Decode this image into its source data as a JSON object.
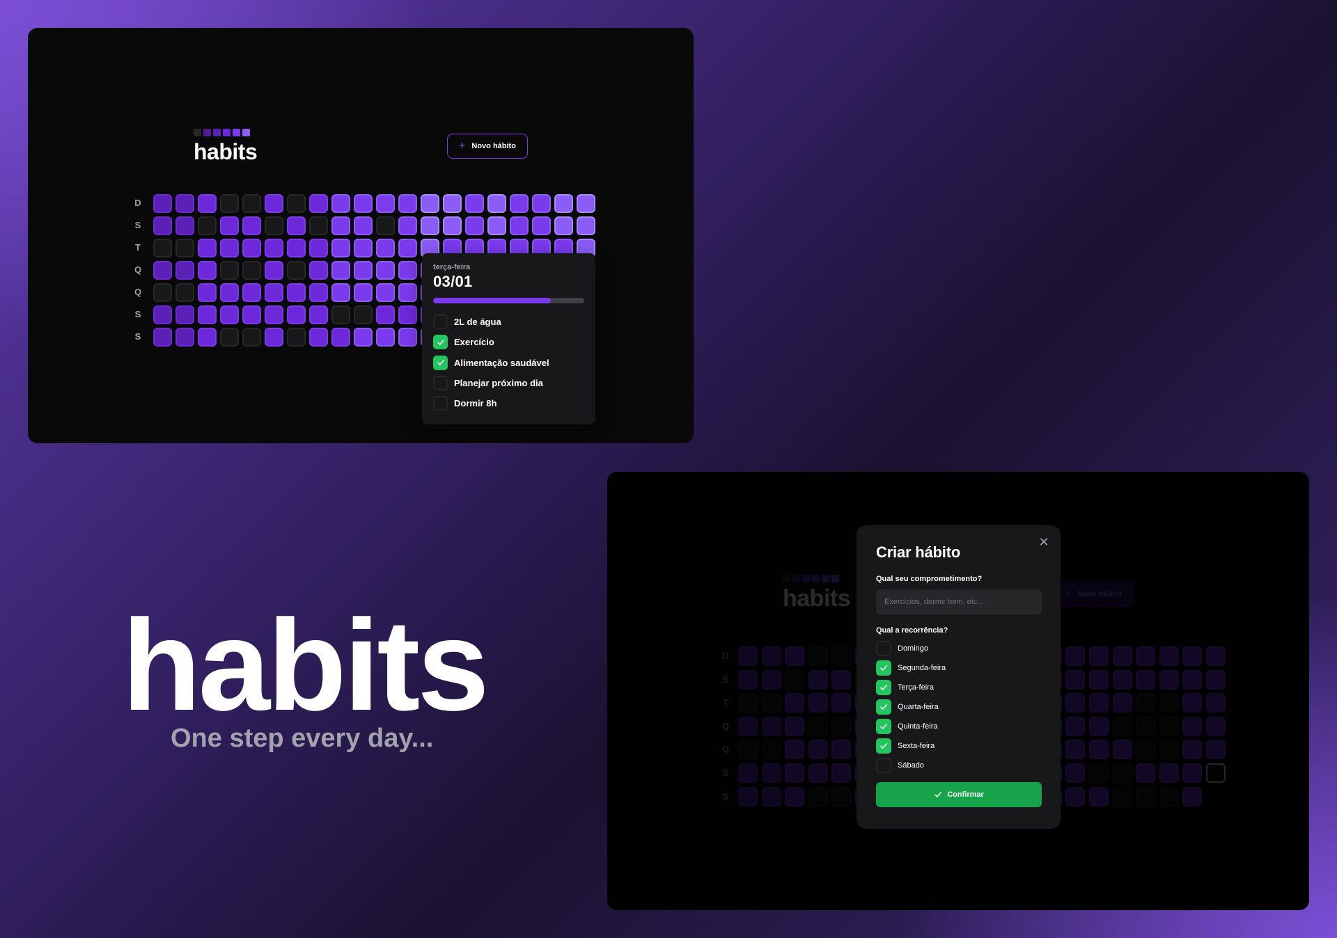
{
  "hero": {
    "title": "habits",
    "subtitle": "One step every day..."
  },
  "app": {
    "logo_text": "habits",
    "new_habit_label": "Novo hábito",
    "weekdays": [
      "D",
      "S",
      "T",
      "Q",
      "Q",
      "S",
      "S"
    ]
  },
  "popover": {
    "weekday": "terça-feira",
    "date": "03/01",
    "progress": 0.78,
    "habits": [
      {
        "label": "2L de água",
        "checked": false
      },
      {
        "label": "Exercício",
        "checked": true
      },
      {
        "label": "Alimentação saudável",
        "checked": true
      },
      {
        "label": "Planejar próximo dia",
        "checked": false
      },
      {
        "label": "Dormir 8h",
        "checked": false
      }
    ]
  },
  "modal": {
    "title": "Criar hábito",
    "commitment_label": "Qual seu comprometimento?",
    "commitment_placeholder": "Exercícios, dormir bem, etc...",
    "commitment_value": "",
    "recurrence_label": "Qual a recorrência?",
    "days": [
      {
        "label": "Domingo",
        "checked": false
      },
      {
        "label": "Segunda-feira",
        "checked": true
      },
      {
        "label": "Terça-feira",
        "checked": true
      },
      {
        "label": "Quarta-feira",
        "checked": true
      },
      {
        "label": "Quinta-feira",
        "checked": true
      },
      {
        "label": "Sexta-feira",
        "checked": true
      },
      {
        "label": "Sábado",
        "checked": false
      }
    ],
    "confirm_label": "Confirmar"
  },
  "heatmap": {
    "top": [
      [
        2,
        2,
        3,
        0,
        0,
        3,
        0,
        3,
        4,
        4,
        4,
        4,
        5,
        5,
        4,
        5,
        4,
        4,
        5,
        5
      ],
      [
        2,
        2,
        0,
        3,
        3,
        0,
        3,
        0,
        4,
        4,
        0,
        4,
        5,
        5,
        4,
        5,
        4,
        4,
        5,
        5
      ],
      [
        0,
        0,
        3,
        3,
        3,
        3,
        3,
        3,
        4,
        4,
        4,
        4,
        5,
        4,
        4,
        4,
        4,
        4,
        4,
        5
      ],
      [
        2,
        2,
        3,
        0,
        0,
        3,
        0,
        3,
        4,
        4,
        4,
        4,
        4,
        4,
        4,
        4,
        4,
        4,
        5,
        5
      ],
      [
        0,
        0,
        3,
        3,
        3,
        3,
        3,
        3,
        4,
        4,
        4,
        4,
        4,
        4,
        4,
        4,
        4,
        4,
        4,
        5
      ],
      [
        2,
        2,
        3,
        3,
        3,
        3,
        3,
        3,
        0,
        0,
        3,
        3,
        3,
        3,
        3,
        3,
        3,
        3,
        3,
        -1
      ],
      [
        2,
        2,
        3,
        0,
        0,
        3,
        0,
        3,
        3,
        4,
        4,
        4,
        4,
        4,
        4,
        4,
        4,
        4,
        null,
        null
      ]
    ],
    "bottom": [
      [
        2,
        2,
        3,
        0,
        0,
        2,
        0,
        2,
        3,
        3,
        3,
        3,
        3,
        3,
        3,
        3,
        3,
        3,
        3,
        3,
        3
      ],
      [
        2,
        2,
        0,
        3,
        3,
        0,
        3,
        0,
        3,
        3,
        0,
        3,
        3,
        3,
        3,
        3,
        3,
        3,
        3,
        3,
        3
      ],
      [
        0,
        0,
        3,
        3,
        3,
        3,
        3,
        3,
        3,
        3,
        3,
        3,
        3,
        3,
        3,
        3,
        3,
        0,
        0,
        3,
        3
      ],
      [
        2,
        2,
        3,
        0,
        0,
        3,
        0,
        3,
        3,
        3,
        3,
        3,
        3,
        3,
        3,
        3,
        0,
        0,
        0,
        3,
        3
      ],
      [
        0,
        0,
        3,
        3,
        3,
        3,
        3,
        3,
        3,
        3,
        3,
        3,
        3,
        3,
        3,
        3,
        3,
        0,
        0,
        3,
        3
      ],
      [
        2,
        2,
        3,
        3,
        3,
        3,
        3,
        3,
        3,
        3,
        3,
        3,
        3,
        3,
        3,
        0,
        0,
        3,
        3,
        3,
        -1
      ],
      [
        2,
        2,
        3,
        0,
        0,
        3,
        0,
        3,
        3,
        3,
        3,
        3,
        3,
        3,
        3,
        3,
        0,
        0,
        0,
        3,
        null
      ]
    ]
  },
  "colors": {
    "logo_dots": [
      "#27272a",
      "#4c1d95",
      "#5b21b6",
      "#6d28d9",
      "#7c3aed",
      "#8b5cf6"
    ],
    "accent": "#7c3aed",
    "success": "#22c55e"
  },
  "icons": {
    "plus": "plus-icon",
    "check": "check-icon",
    "close": "close-icon"
  }
}
